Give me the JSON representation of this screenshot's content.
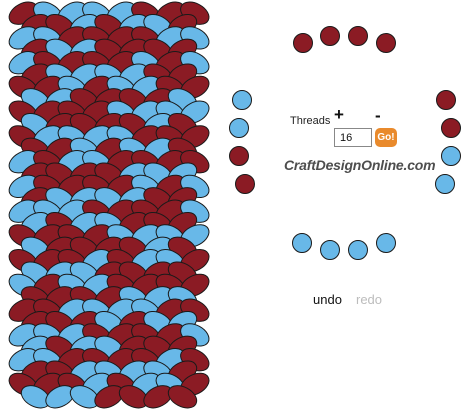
{
  "colors": {
    "a": "#8b1b24",
    "b": "#68b8e8"
  },
  "pattern": {
    "columns": 16,
    "rows": 32,
    "column_colors": [
      "a",
      "a",
      "b",
      "a",
      "b",
      "a",
      "b",
      "b",
      "b",
      "a",
      "a",
      "b",
      "a",
      "b",
      "a",
      "a"
    ]
  },
  "controls": {
    "threads_label": "Threads",
    "add_label": "+",
    "remove_label": "-",
    "thread_count": "16",
    "go_label": "Go!",
    "undo_label": "undo",
    "redo_label": "redo"
  },
  "brand": "CraftDesignOnline.com",
  "thread_dots": {
    "top": [
      "a",
      "a",
      "a",
      "a"
    ],
    "left": [
      "b",
      "b",
      "a",
      "a"
    ],
    "right": [
      "a",
      "a",
      "b",
      "b"
    ],
    "bottom": [
      "b",
      "b",
      "b",
      "b"
    ]
  }
}
